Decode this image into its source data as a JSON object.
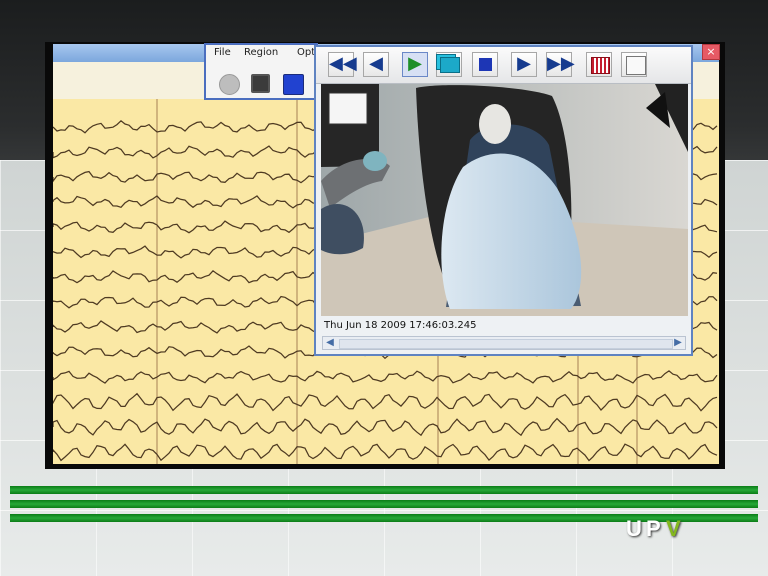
{
  "brand": {
    "logo_text": "UPV"
  },
  "small_toolbar": {
    "menu": [
      "File",
      "Region",
      "Opt"
    ]
  },
  "eeg": {
    "close_symbol": "×"
  },
  "video": {
    "timestamp": "Thu Jun 18 2009   17:46:03.245",
    "controls": [
      "rewind",
      "step-back",
      "play",
      "copy",
      "stop",
      "step-forward",
      "fast-forward",
      "grid",
      "save"
    ],
    "scroll_left_symbol": "◀",
    "scroll_right_symbol": "▶"
  },
  "colors": {
    "eeg_background": "#fae8a5",
    "window_border": "#5f83c1",
    "green_accent": "#27a838"
  }
}
